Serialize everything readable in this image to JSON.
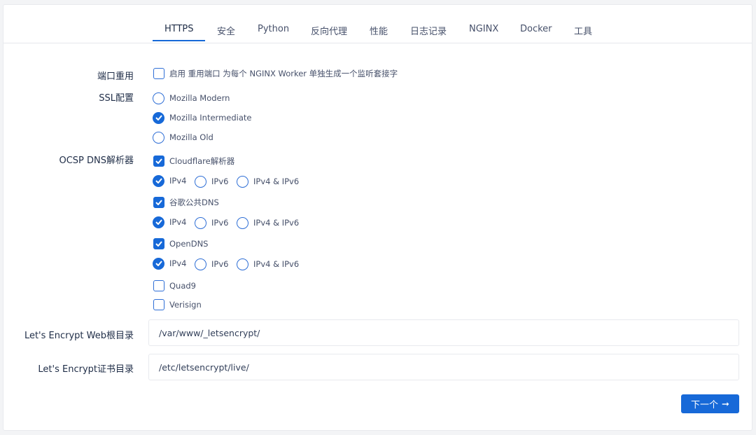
{
  "tabs": [
    {
      "label": "HTTPS",
      "active": true
    },
    {
      "label": "安全"
    },
    {
      "label": "Python"
    },
    {
      "label": "反向代理"
    },
    {
      "label": "性能"
    },
    {
      "label": "日志记录"
    },
    {
      "label": "NGINX"
    },
    {
      "label": "Docker"
    },
    {
      "label": "工具"
    }
  ],
  "form": {
    "port_reuse": {
      "label": "端口重用",
      "checkbox_label": "启用 重用端口 为每个 NGINX Worker 单独生成一个监听套接字",
      "checked": false
    },
    "ssl": {
      "label": "SSL配置",
      "options": [
        {
          "label": "Mozilla Modern",
          "selected": false
        },
        {
          "label": "Mozilla Intermediate",
          "selected": true
        },
        {
          "label": "Mozilla Old",
          "selected": false
        }
      ]
    },
    "ocsp": {
      "label": "OCSP DNS解析器",
      "resolvers": [
        {
          "label": "Cloudflare解析器",
          "checked": true,
          "ip": [
            "IPv4",
            "IPv6",
            "IPv4 & IPv6"
          ],
          "ip_selected": "IPv4"
        },
        {
          "label": "谷歌公共DNS",
          "checked": true,
          "ip": [
            "IPv4",
            "IPv6",
            "IPv4 & IPv6"
          ],
          "ip_selected": "IPv4"
        },
        {
          "label": "OpenDNS",
          "checked": true,
          "ip": [
            "IPv4",
            "IPv6",
            "IPv4 & IPv6"
          ],
          "ip_selected": "IPv4"
        },
        {
          "label": "Quad9",
          "checked": false
        },
        {
          "label": "Verisign",
          "checked": false
        }
      ]
    },
    "webroot": {
      "label": "Let's Encrypt Web根目录",
      "value": "/var/www/_letsencrypt/"
    },
    "certdir": {
      "label": "Let's Encrypt证书目录",
      "value": "/etc/letsencrypt/live/"
    }
  },
  "next_button": {
    "label": "下一个",
    "icon": "arrow-right-icon",
    "arrow": "➞"
  },
  "colors": {
    "accent": "#1769d8",
    "text": "#1f2d47",
    "muted": "#46506a",
    "border": "#e5e7eb"
  }
}
